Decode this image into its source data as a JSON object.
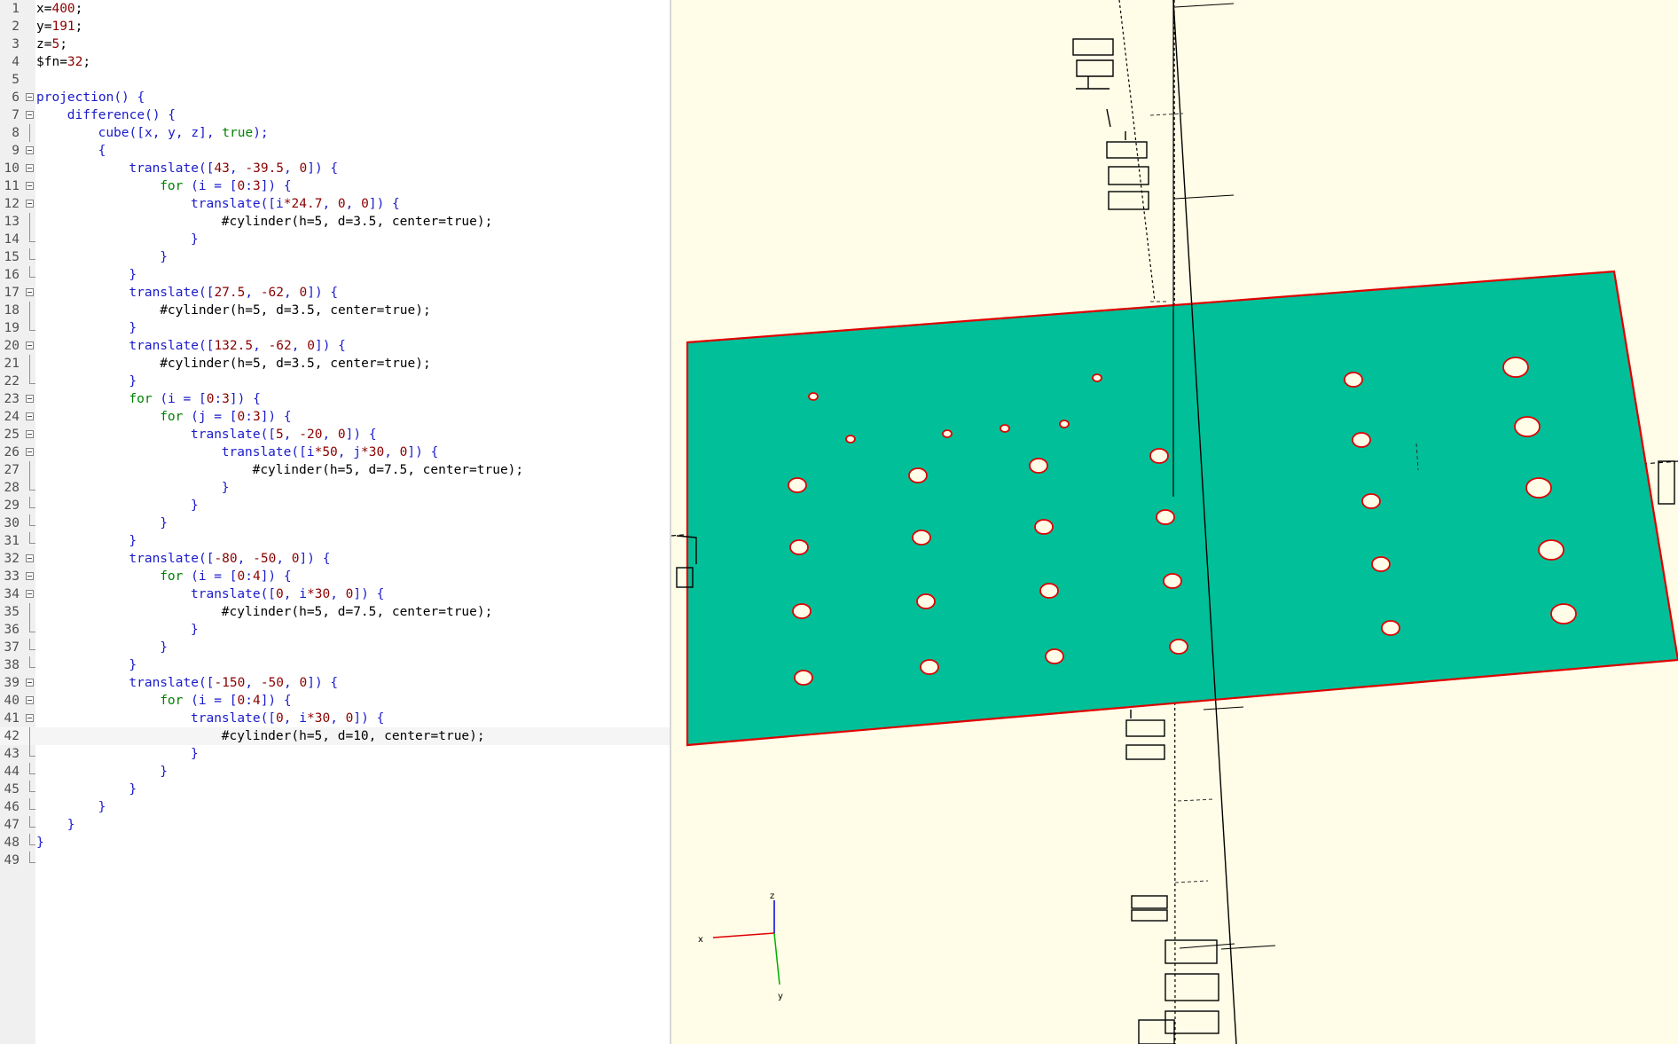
{
  "editor": {
    "current_line": 42,
    "lines": [
      {
        "n": "1",
        "fold": "none",
        "indent": 0,
        "tokens": [
          {
            "t": "x=",
            "c": "plain"
          },
          {
            "t": "400",
            "c": "num"
          },
          {
            "t": ";",
            "c": "plain"
          }
        ]
      },
      {
        "n": "2",
        "fold": "none",
        "indent": 0,
        "tokens": [
          {
            "t": "y=",
            "c": "plain"
          },
          {
            "t": "191",
            "c": "num"
          },
          {
            "t": ";",
            "c": "plain"
          }
        ]
      },
      {
        "n": "3",
        "fold": "none",
        "indent": 0,
        "tokens": [
          {
            "t": "z=",
            "c": "plain"
          },
          {
            "t": "5",
            "c": "num"
          },
          {
            "t": ";",
            "c": "plain"
          }
        ]
      },
      {
        "n": "4",
        "fold": "none",
        "indent": 0,
        "tokens": [
          {
            "t": "$fn=",
            "c": "plain"
          },
          {
            "t": "32",
            "c": "num"
          },
          {
            "t": ";",
            "c": "plain"
          }
        ]
      },
      {
        "n": "5",
        "fold": "none",
        "indent": 0,
        "tokens": []
      },
      {
        "n": "6",
        "fold": "open",
        "indent": 0,
        "tokens": [
          {
            "t": "projection",
            "c": "kw"
          },
          {
            "t": "() {",
            "c": "kw"
          }
        ]
      },
      {
        "n": "7",
        "fold": "open",
        "indent": 4,
        "tokens": [
          {
            "t": "difference",
            "c": "kw"
          },
          {
            "t": "() {",
            "c": "kw"
          }
        ]
      },
      {
        "n": "8",
        "fold": "bar",
        "indent": 8,
        "tokens": [
          {
            "t": "cube",
            "c": "kw"
          },
          {
            "t": "([x, y, z], ",
            "c": "kw"
          },
          {
            "t": "true",
            "c": "bool"
          },
          {
            "t": ");",
            "c": "kw"
          }
        ]
      },
      {
        "n": "9",
        "fold": "open",
        "indent": 8,
        "tokens": [
          {
            "t": "{",
            "c": "kw"
          }
        ]
      },
      {
        "n": "10",
        "fold": "open",
        "indent": 12,
        "tokens": [
          {
            "t": "translate",
            "c": "kw"
          },
          {
            "t": "([",
            "c": "kw"
          },
          {
            "t": "43",
            "c": "num"
          },
          {
            "t": ", ",
            "c": "kw"
          },
          {
            "t": "-39.5",
            "c": "num"
          },
          {
            "t": ", ",
            "c": "kw"
          },
          {
            "t": "0",
            "c": "num"
          },
          {
            "t": "]) {",
            "c": "kw"
          }
        ]
      },
      {
        "n": "11",
        "fold": "open",
        "indent": 16,
        "tokens": [
          {
            "t": "for",
            "c": "ctl"
          },
          {
            "t": " (i = [",
            "c": "kw"
          },
          {
            "t": "0",
            "c": "num"
          },
          {
            "t": ":",
            "c": "kw"
          },
          {
            "t": "3",
            "c": "num"
          },
          {
            "t": "]) {",
            "c": "kw"
          }
        ]
      },
      {
        "n": "12",
        "fold": "open",
        "indent": 20,
        "tokens": [
          {
            "t": "translate",
            "c": "kw"
          },
          {
            "t": "([i",
            "c": "kw"
          },
          {
            "t": "*",
            "c": "op"
          },
          {
            "t": "24.7",
            "c": "num"
          },
          {
            "t": ", ",
            "c": "kw"
          },
          {
            "t": "0",
            "c": "num"
          },
          {
            "t": ", ",
            "c": "kw"
          },
          {
            "t": "0",
            "c": "num"
          },
          {
            "t": "]) {",
            "c": "kw"
          }
        ]
      },
      {
        "n": "13",
        "fold": "bar",
        "indent": 24,
        "tokens": [
          {
            "t": "#cylinder(h=5, d=3.5, center=true);",
            "c": "mod"
          }
        ]
      },
      {
        "n": "14",
        "fold": "end",
        "indent": 20,
        "tokens": [
          {
            "t": "}",
            "c": "kw"
          }
        ]
      },
      {
        "n": "15",
        "fold": "end",
        "indent": 16,
        "tokens": [
          {
            "t": "}",
            "c": "kw"
          }
        ]
      },
      {
        "n": "16",
        "fold": "end",
        "indent": 12,
        "tokens": [
          {
            "t": "}",
            "c": "kw"
          }
        ]
      },
      {
        "n": "17",
        "fold": "open",
        "indent": 12,
        "tokens": [
          {
            "t": "translate",
            "c": "kw"
          },
          {
            "t": "([",
            "c": "kw"
          },
          {
            "t": "27.5",
            "c": "num"
          },
          {
            "t": ", ",
            "c": "kw"
          },
          {
            "t": "-62",
            "c": "num"
          },
          {
            "t": ", ",
            "c": "kw"
          },
          {
            "t": "0",
            "c": "num"
          },
          {
            "t": "]) {",
            "c": "kw"
          }
        ]
      },
      {
        "n": "18",
        "fold": "bar",
        "indent": 16,
        "tokens": [
          {
            "t": "#cylinder(h=5, d=3.5, center=true);",
            "c": "mod"
          }
        ]
      },
      {
        "n": "19",
        "fold": "end",
        "indent": 12,
        "tokens": [
          {
            "t": "}",
            "c": "kw"
          }
        ]
      },
      {
        "n": "20",
        "fold": "open",
        "indent": 12,
        "tokens": [
          {
            "t": "translate",
            "c": "kw"
          },
          {
            "t": "([",
            "c": "kw"
          },
          {
            "t": "132.5",
            "c": "num"
          },
          {
            "t": ", ",
            "c": "kw"
          },
          {
            "t": "-62",
            "c": "num"
          },
          {
            "t": ", ",
            "c": "kw"
          },
          {
            "t": "0",
            "c": "num"
          },
          {
            "t": "]) {",
            "c": "kw"
          }
        ]
      },
      {
        "n": "21",
        "fold": "bar",
        "indent": 16,
        "tokens": [
          {
            "t": "#cylinder(h=5, d=3.5, center=true);",
            "c": "mod"
          }
        ]
      },
      {
        "n": "22",
        "fold": "end",
        "indent": 12,
        "tokens": [
          {
            "t": "}",
            "c": "kw"
          }
        ]
      },
      {
        "n": "23",
        "fold": "open",
        "indent": 12,
        "tokens": [
          {
            "t": "for",
            "c": "ctl"
          },
          {
            "t": " (i = [",
            "c": "kw"
          },
          {
            "t": "0",
            "c": "num"
          },
          {
            "t": ":",
            "c": "kw"
          },
          {
            "t": "3",
            "c": "num"
          },
          {
            "t": "]) {",
            "c": "kw"
          }
        ]
      },
      {
        "n": "24",
        "fold": "open",
        "indent": 16,
        "tokens": [
          {
            "t": "for",
            "c": "ctl"
          },
          {
            "t": " (j = [",
            "c": "kw"
          },
          {
            "t": "0",
            "c": "num"
          },
          {
            "t": ":",
            "c": "kw"
          },
          {
            "t": "3",
            "c": "num"
          },
          {
            "t": "]) {",
            "c": "kw"
          }
        ]
      },
      {
        "n": "25",
        "fold": "open",
        "indent": 20,
        "tokens": [
          {
            "t": "translate",
            "c": "kw"
          },
          {
            "t": "([",
            "c": "kw"
          },
          {
            "t": "5",
            "c": "num"
          },
          {
            "t": ", ",
            "c": "kw"
          },
          {
            "t": "-20",
            "c": "num"
          },
          {
            "t": ", ",
            "c": "kw"
          },
          {
            "t": "0",
            "c": "num"
          },
          {
            "t": "]) {",
            "c": "kw"
          }
        ]
      },
      {
        "n": "26",
        "fold": "open",
        "indent": 24,
        "tokens": [
          {
            "t": "translate",
            "c": "kw"
          },
          {
            "t": "([i",
            "c": "kw"
          },
          {
            "t": "*",
            "c": "op"
          },
          {
            "t": "50",
            "c": "num"
          },
          {
            "t": ", j",
            "c": "kw"
          },
          {
            "t": "*",
            "c": "op"
          },
          {
            "t": "30",
            "c": "num"
          },
          {
            "t": ", ",
            "c": "kw"
          },
          {
            "t": "0",
            "c": "num"
          },
          {
            "t": "]) {",
            "c": "kw"
          }
        ]
      },
      {
        "n": "27",
        "fold": "bar",
        "indent": 28,
        "tokens": [
          {
            "t": "#cylinder(h=5, d=7.5, center=true);",
            "c": "mod"
          }
        ]
      },
      {
        "n": "28",
        "fold": "end",
        "indent": 24,
        "tokens": [
          {
            "t": "}",
            "c": "kw"
          }
        ]
      },
      {
        "n": "29",
        "fold": "end",
        "indent": 20,
        "tokens": [
          {
            "t": "}",
            "c": "kw"
          }
        ]
      },
      {
        "n": "30",
        "fold": "end",
        "indent": 16,
        "tokens": [
          {
            "t": "}",
            "c": "kw"
          }
        ]
      },
      {
        "n": "31",
        "fold": "end",
        "indent": 12,
        "tokens": [
          {
            "t": "}",
            "c": "kw"
          }
        ]
      },
      {
        "n": "32",
        "fold": "open",
        "indent": 12,
        "tokens": [
          {
            "t": "translate",
            "c": "kw"
          },
          {
            "t": "([",
            "c": "kw"
          },
          {
            "t": "-80",
            "c": "num"
          },
          {
            "t": ", ",
            "c": "kw"
          },
          {
            "t": "-50",
            "c": "num"
          },
          {
            "t": ", ",
            "c": "kw"
          },
          {
            "t": "0",
            "c": "num"
          },
          {
            "t": "]) {",
            "c": "kw"
          }
        ]
      },
      {
        "n": "33",
        "fold": "open",
        "indent": 16,
        "tokens": [
          {
            "t": "for",
            "c": "ctl"
          },
          {
            "t": " (i = [",
            "c": "kw"
          },
          {
            "t": "0",
            "c": "num"
          },
          {
            "t": ":",
            "c": "kw"
          },
          {
            "t": "4",
            "c": "num"
          },
          {
            "t": "]) {",
            "c": "kw"
          }
        ]
      },
      {
        "n": "34",
        "fold": "open",
        "indent": 20,
        "tokens": [
          {
            "t": "translate",
            "c": "kw"
          },
          {
            "t": "([",
            "c": "kw"
          },
          {
            "t": "0",
            "c": "num"
          },
          {
            "t": ", i",
            "c": "kw"
          },
          {
            "t": "*",
            "c": "op"
          },
          {
            "t": "30",
            "c": "num"
          },
          {
            "t": ", ",
            "c": "kw"
          },
          {
            "t": "0",
            "c": "num"
          },
          {
            "t": "]) {",
            "c": "kw"
          }
        ]
      },
      {
        "n": "35",
        "fold": "bar",
        "indent": 24,
        "tokens": [
          {
            "t": "#cylinder(h=5, d=7.5, center=true);",
            "c": "mod"
          }
        ]
      },
      {
        "n": "36",
        "fold": "end",
        "indent": 20,
        "tokens": [
          {
            "t": "}",
            "c": "kw"
          }
        ]
      },
      {
        "n": "37",
        "fold": "end",
        "indent": 16,
        "tokens": [
          {
            "t": "}",
            "c": "kw"
          }
        ]
      },
      {
        "n": "38",
        "fold": "end",
        "indent": 12,
        "tokens": [
          {
            "t": "}",
            "c": "kw"
          }
        ]
      },
      {
        "n": "39",
        "fold": "open",
        "indent": 12,
        "tokens": [
          {
            "t": "translate",
            "c": "kw"
          },
          {
            "t": "([",
            "c": "kw"
          },
          {
            "t": "-150",
            "c": "num"
          },
          {
            "t": ", ",
            "c": "kw"
          },
          {
            "t": "-50",
            "c": "num"
          },
          {
            "t": ", ",
            "c": "kw"
          },
          {
            "t": "0",
            "c": "num"
          },
          {
            "t": "]) {",
            "c": "kw"
          }
        ]
      },
      {
        "n": "40",
        "fold": "open",
        "indent": 16,
        "tokens": [
          {
            "t": "for",
            "c": "ctl"
          },
          {
            "t": " (i = [",
            "c": "kw"
          },
          {
            "t": "0",
            "c": "num"
          },
          {
            "t": ":",
            "c": "kw"
          },
          {
            "t": "4",
            "c": "num"
          },
          {
            "t": "]) {",
            "c": "kw"
          }
        ]
      },
      {
        "n": "41",
        "fold": "open",
        "indent": 20,
        "tokens": [
          {
            "t": "translate",
            "c": "kw"
          },
          {
            "t": "([",
            "c": "kw"
          },
          {
            "t": "0",
            "c": "num"
          },
          {
            "t": ", i",
            "c": "kw"
          },
          {
            "t": "*",
            "c": "op"
          },
          {
            "t": "30",
            "c": "num"
          },
          {
            "t": ", ",
            "c": "kw"
          },
          {
            "t": "0",
            "c": "num"
          },
          {
            "t": "]) {",
            "c": "kw"
          }
        ]
      },
      {
        "n": "42",
        "fold": "bar",
        "indent": 24,
        "tokens": [
          {
            "t": "#cylinder(h=5, d=10, center=true);",
            "c": "mod"
          }
        ]
      },
      {
        "n": "43",
        "fold": "end",
        "indent": 20,
        "tokens": [
          {
            "t": "}",
            "c": "kw"
          }
        ]
      },
      {
        "n": "44",
        "fold": "end",
        "indent": 16,
        "tokens": [
          {
            "t": "}",
            "c": "kw"
          }
        ]
      },
      {
        "n": "45",
        "fold": "end",
        "indent": 12,
        "tokens": [
          {
            "t": "}",
            "c": "kw"
          }
        ]
      },
      {
        "n": "46",
        "fold": "end",
        "indent": 8,
        "tokens": [
          {
            "t": "}",
            "c": "kw"
          }
        ]
      },
      {
        "n": "47",
        "fold": "end",
        "indent": 4,
        "tokens": [
          {
            "t": "}",
            "c": "kw"
          }
        ]
      },
      {
        "n": "48",
        "fold": "end",
        "indent": 0,
        "tokens": [
          {
            "t": "}",
            "c": "kw"
          }
        ]
      },
      {
        "n": "49",
        "fold": "end",
        "indent": 0,
        "tokens": []
      }
    ]
  },
  "viewport": {
    "background_color": "#fffde7",
    "plate_color": "#00bf99",
    "plate_outline_color": "#e00000",
    "hole_color": "#fffde7",
    "hole_outline_color": "#e00000",
    "axes": {
      "x_label": "x",
      "y_label": "y",
      "z_label": "z",
      "x_color": "#e00000",
      "y_color": "#00b000",
      "z_color": "#0000e0"
    },
    "scale_labels": [
      "200",
      "100",
      "-100",
      "-200"
    ]
  }
}
